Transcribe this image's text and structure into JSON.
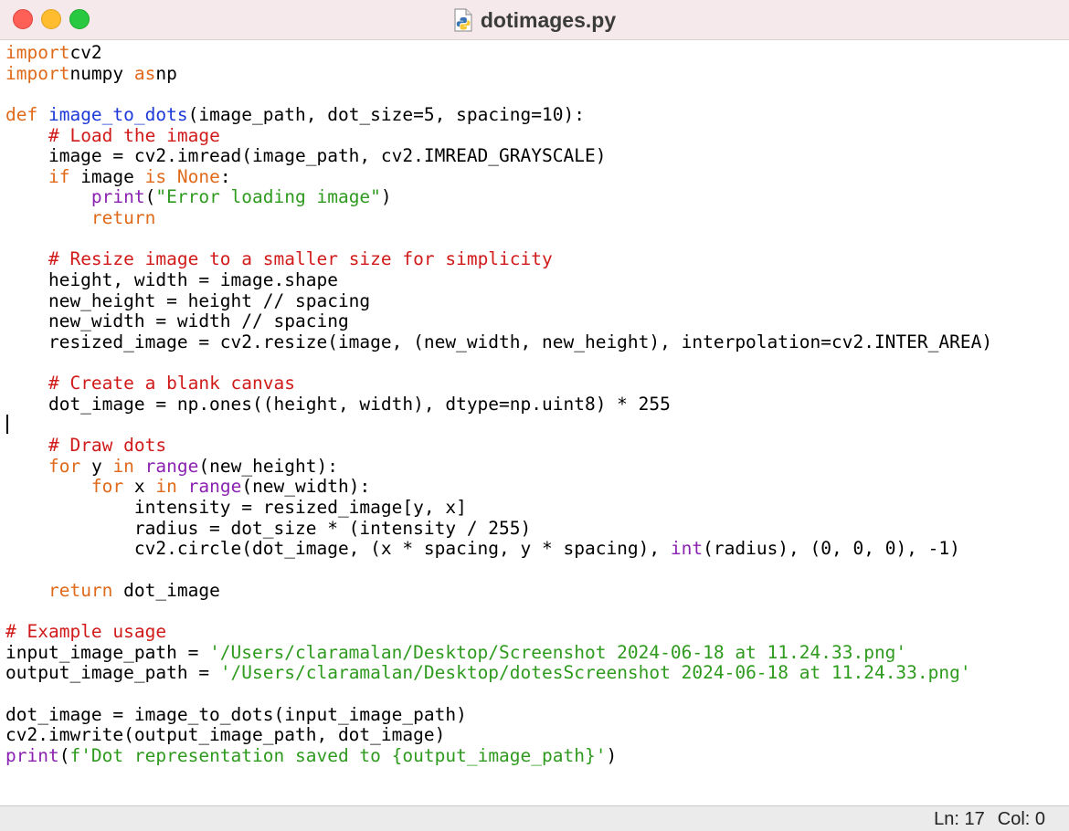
{
  "window": {
    "title": "dotimages.py",
    "file_icon": "python-file-icon"
  },
  "status": {
    "line": "Ln: 17",
    "col": "Col: 0"
  },
  "code_lines": [
    [
      [
        "kw",
        "import"
      ],
      [
        "",
        "cv2"
      ]
    ],
    [
      [
        "kw",
        "import"
      ],
      [
        "",
        "numpy "
      ],
      [
        "kw",
        "as"
      ],
      [
        "",
        "np"
      ]
    ],
    [],
    [
      [
        "kw",
        "def "
      ],
      [
        "fn",
        "image_to_dots"
      ],
      [
        "",
        "(image_path, dot_size=5, spacing=10):"
      ]
    ],
    [
      [
        "",
        "    "
      ],
      [
        "cm",
        "# Load the image"
      ]
    ],
    [
      [
        "",
        "    image = cv2.imread(image_path, cv2.IMREAD_GRAYSCALE)"
      ]
    ],
    [
      [
        "",
        "    "
      ],
      [
        "kw",
        "if"
      ],
      [
        "",
        " image "
      ],
      [
        "kw",
        "is None"
      ],
      [
        "",
        ":"
      ]
    ],
    [
      [
        "",
        "        "
      ],
      [
        "bi",
        "print"
      ],
      [
        "",
        "("
      ],
      [
        "st",
        "\"Error loading image\""
      ],
      [
        "",
        ")"
      ]
    ],
    [
      [
        "",
        "        "
      ],
      [
        "kw",
        "return"
      ]
    ],
    [],
    [
      [
        "",
        "    "
      ],
      [
        "cm",
        "# Resize image to a smaller size for simplicity"
      ]
    ],
    [
      [
        "",
        "    height, width = image.shape"
      ]
    ],
    [
      [
        "",
        "    new_height = height // spacing"
      ]
    ],
    [
      [
        "",
        "    new_width = width // spacing"
      ]
    ],
    [
      [
        "",
        "    resized_image = cv2.resize(image, (new_width, new_height), interpolation=cv2.INTER_AREA)"
      ]
    ],
    [],
    [
      [
        "",
        "    "
      ],
      [
        "cm",
        "# Create a blank canvas"
      ]
    ],
    [
      [
        "",
        "    dot_image = np.ones((height, width), dtype=np.uint8) * 255"
      ]
    ],
    [],
    [
      [
        "",
        "    "
      ],
      [
        "cm",
        "# Draw dots"
      ]
    ],
    [
      [
        "",
        "    "
      ],
      [
        "kw",
        "for"
      ],
      [
        "",
        " y "
      ],
      [
        "kw",
        "in "
      ],
      [
        "bi",
        "range"
      ],
      [
        "",
        "(new_height):"
      ]
    ],
    [
      [
        "",
        "        "
      ],
      [
        "kw",
        "for"
      ],
      [
        "",
        " x "
      ],
      [
        "kw",
        "in "
      ],
      [
        "bi",
        "range"
      ],
      [
        "",
        "(new_width):"
      ]
    ],
    [
      [
        "",
        "            intensity = resized_image[y, x]"
      ]
    ],
    [
      [
        "",
        "            radius = dot_size * (intensity / 255)"
      ]
    ],
    [
      [
        "",
        "            cv2.circle(dot_image, (x * spacing, y * spacing), "
      ],
      [
        "bi",
        "int"
      ],
      [
        "",
        "(radius), (0, 0, 0), -1)"
      ]
    ],
    [],
    [
      [
        "",
        "    "
      ],
      [
        "kw",
        "return"
      ],
      [
        "",
        " dot_image"
      ]
    ],
    [],
    [
      [
        "cm",
        "# Example usage"
      ]
    ],
    [
      [
        "",
        "input_image_path = "
      ],
      [
        "st",
        "'/Users/claramalan/Desktop/Screenshot 2024-06-18 at 11.24.33.png'"
      ]
    ],
    [
      [
        "",
        "output_image_path = "
      ],
      [
        "st",
        "'/Users/claramalan/Desktop/dotesScreenshot 2024-06-18 at 11.24.33.png'"
      ]
    ],
    [],
    [
      [
        "",
        "dot_image = image_to_dots(input_image_path)"
      ]
    ],
    [
      [
        "",
        "cv2.imwrite(output_image_path, dot_image)"
      ]
    ],
    [
      [
        "bi",
        "print"
      ],
      [
        "",
        "("
      ],
      [
        "st",
        "f'Dot representation saved to {output_image_path}'"
      ],
      [
        "",
        ")"
      ]
    ]
  ]
}
